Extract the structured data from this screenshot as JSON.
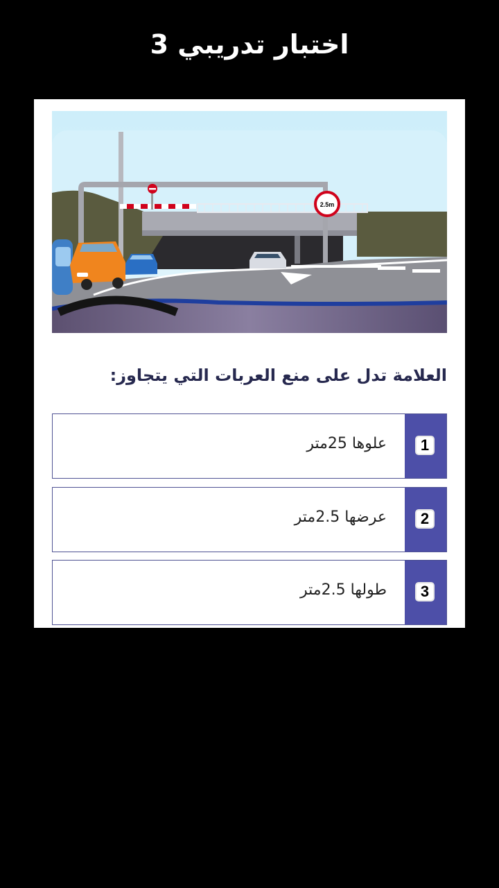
{
  "header": {
    "title": "اختبار تدريبي 3"
  },
  "question": {
    "text": "العلامة تدل على منع العربات التي يتجاوز:"
  },
  "sign": {
    "label": "2.5m",
    "color": "#d0021b"
  },
  "options": [
    {
      "number": "1",
      "text": "علوها 25متر"
    },
    {
      "number": "2",
      "text": "عرضها 2.5متر"
    },
    {
      "number": "3",
      "text": "طولها 2.5متر"
    }
  ],
  "colors": {
    "accent": "#4d4fa8",
    "border": "#4f5293",
    "question_text": "#27294f"
  }
}
